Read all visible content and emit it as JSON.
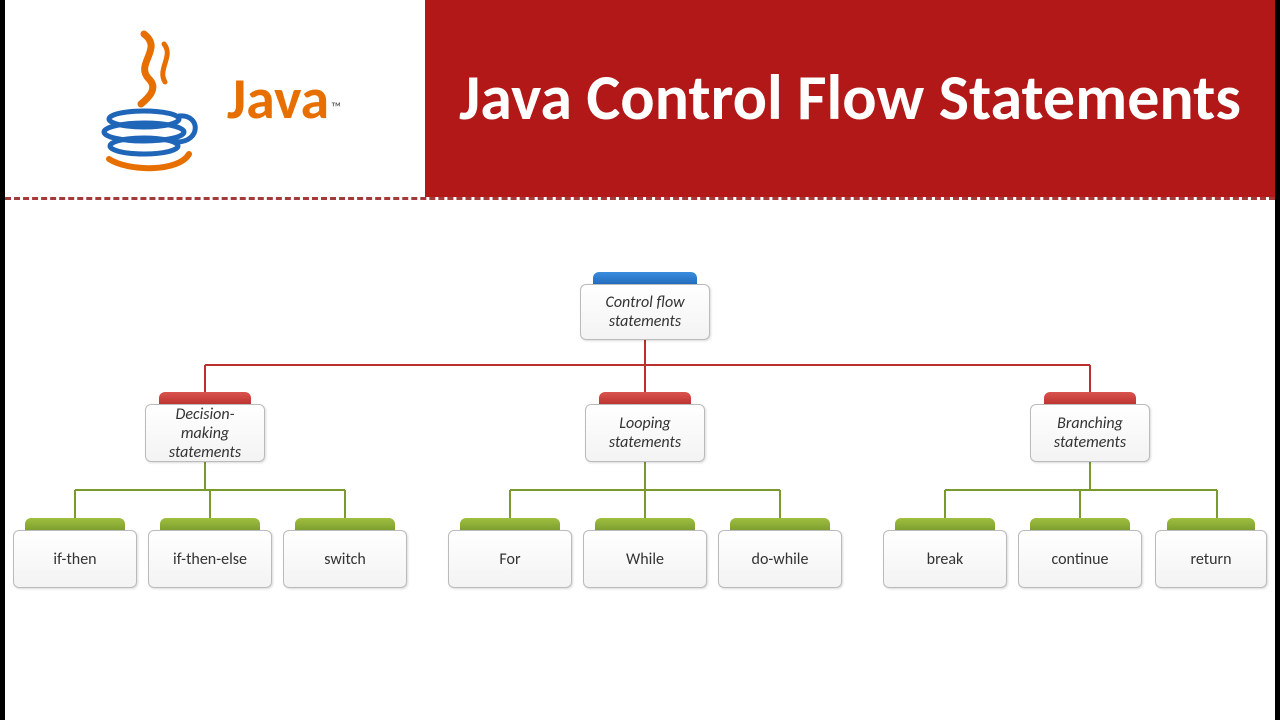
{
  "header": {
    "logo_text": "Java",
    "tm": "™",
    "title": "Java Control Flow Statements"
  },
  "diagram": {
    "root": {
      "label": "Control flow statements"
    },
    "branches": [
      {
        "label": "Decision-making statements",
        "children": [
          {
            "label": "if-then"
          },
          {
            "label": "if-then-else"
          },
          {
            "label": "switch"
          }
        ]
      },
      {
        "label": "Looping statements",
        "children": [
          {
            "label": "For"
          },
          {
            "label": "While"
          },
          {
            "label": "do-while"
          }
        ]
      },
      {
        "label": "Branching statements",
        "children": [
          {
            "label": "break"
          },
          {
            "label": "continue"
          },
          {
            "label": "return"
          }
        ]
      }
    ]
  },
  "colors": {
    "banner": "#b31818",
    "root_tab": "#1f66b8",
    "branch_tab": "#b9302c",
    "leaf_tab": "#7a9a2e"
  }
}
